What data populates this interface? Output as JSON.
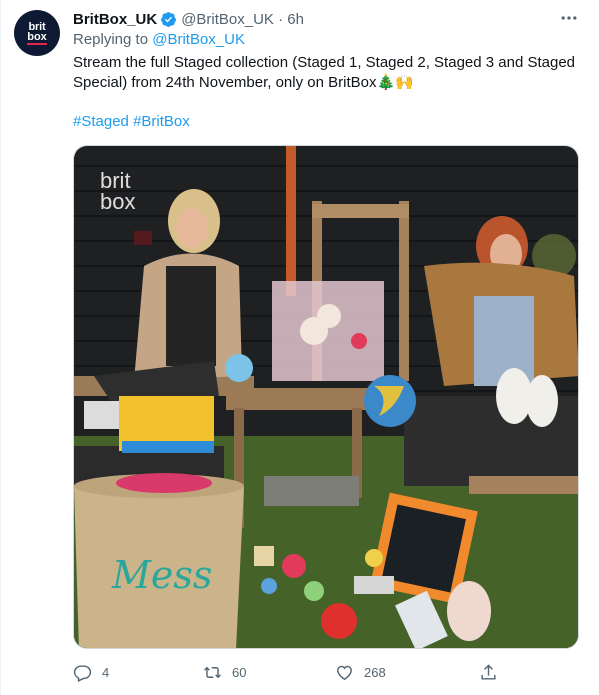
{
  "tweet": {
    "avatar": {
      "line1": "brit",
      "line2": "box"
    },
    "display_name": "BritBox_UK",
    "handle_time": "@BritBox_UK · 6h",
    "replying_prefix": "Replying to ",
    "replying_handle": "@BritBox_UK",
    "text": "Stream the full Staged collection (Staged 1, Staged 2, Staged 3 and Staged Special) from 24th November, only on BritBox🎄🙌",
    "hashtags": [
      "#Staged",
      "#BritBox"
    ],
    "media": {
      "watermark_line1": "brit",
      "watermark_line2": "box",
      "basket_text": "Mess"
    },
    "actions": {
      "replies": "4",
      "retweets": "60",
      "likes": "268"
    }
  },
  "colors": {
    "accent": "#1d9bf0",
    "secondary_text": "#536471",
    "brand_red": "#e4244b",
    "avatar_bg": "#0e1a33"
  }
}
